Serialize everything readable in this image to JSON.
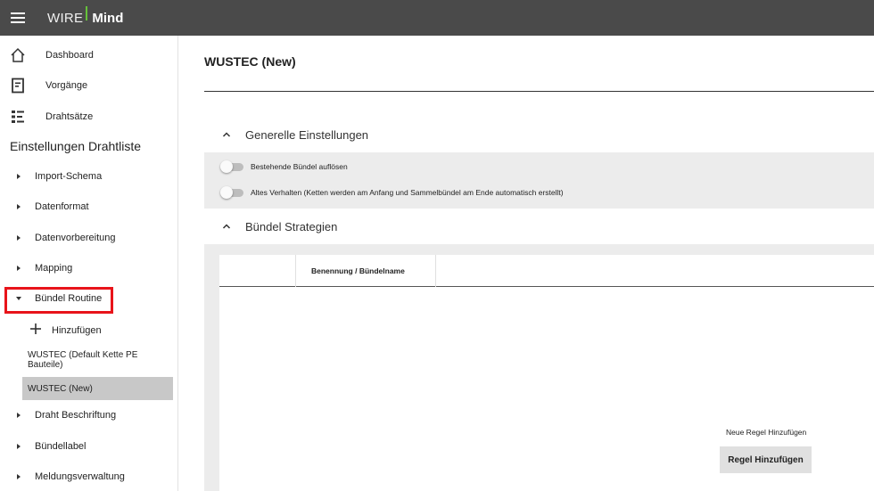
{
  "app": {
    "logo_wire": "WIRE",
    "logo_mind": "Mind",
    "accent_color": "#66c23a",
    "topbar_color": "#4a4a4a"
  },
  "sidebar": {
    "nav": [
      {
        "label": "Dashboard",
        "icon": "home-icon"
      },
      {
        "label": "Vorgänge",
        "icon": "document-icon"
      },
      {
        "label": "Drahtsätze",
        "icon": "list-tree-icon"
      }
    ],
    "section_title": "Einstellungen Drahtliste",
    "tree": [
      {
        "label": "Import-Schema",
        "expanded": false
      },
      {
        "label": "Datenformat",
        "expanded": false
      },
      {
        "label": "Datenvorbereitung",
        "expanded": false
      },
      {
        "label": "Mapping",
        "expanded": false
      },
      {
        "label": "Bündel Routine",
        "expanded": true
      },
      {
        "label": "Draht Beschriftung",
        "expanded": false
      },
      {
        "label": "Bündellabel",
        "expanded": false
      },
      {
        "label": "Meldungsverwaltung",
        "expanded": false
      }
    ],
    "add_label": "Hinzufügen",
    "sub_items": [
      {
        "label": "WUSTEC (Default Kette PE Bauteile)",
        "active": false
      },
      {
        "label": "WUSTEC (New)",
        "active": true
      }
    ]
  },
  "main": {
    "title": "WUSTEC (New)",
    "general": {
      "heading": "Generelle Einstellungen",
      "toggles": [
        {
          "label": "Bestehende Bündel auflösen",
          "on": false
        },
        {
          "label": "Altes Verhalten (Ketten werden am Anfang und Sammelbündel am Ende automatisch erstellt)",
          "on": false
        }
      ]
    },
    "strategies": {
      "heading": "Bündel Strategien",
      "columns": [
        "",
        "Benennung / Bündelname"
      ],
      "rule_label": "Neue Regel Hinzufügen",
      "rule_button": "Regel Hinzufügen"
    }
  },
  "highlight_color": "#e8141a"
}
